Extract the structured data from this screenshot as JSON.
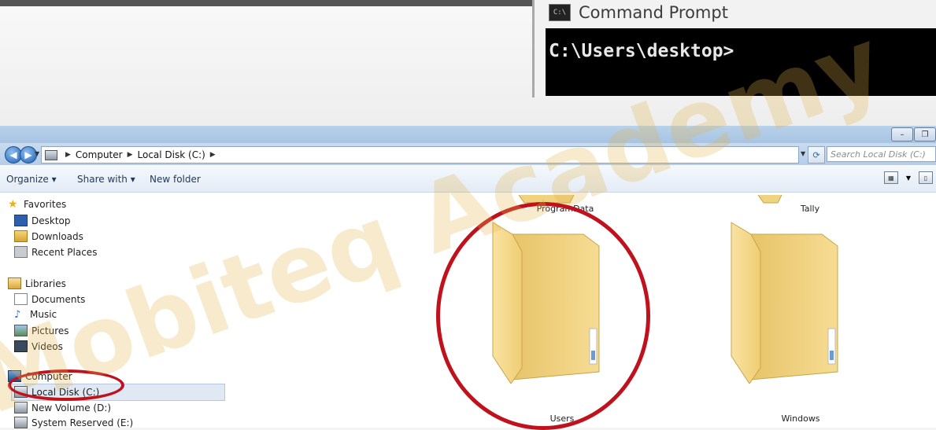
{
  "command_prompt": {
    "title": "Command Prompt",
    "icon_text": "C:\\",
    "prompt_line": "C:\\Users\\desktop>"
  },
  "explorer": {
    "breadcrumb": [
      "Computer",
      "Local Disk (C:)"
    ],
    "search_placeholder": "Search Local Disk (C:)",
    "toolbar": {
      "organize": "Organize ▾",
      "share_with": "Share with ▾",
      "new_folder": "New folder"
    },
    "nav": {
      "favorites": {
        "label": "Favorites",
        "items": [
          "Desktop",
          "Downloads",
          "Recent Places"
        ]
      },
      "libraries": {
        "label": "Libraries",
        "items": [
          "Documents",
          "Music",
          "Pictures",
          "Videos"
        ]
      },
      "computer": {
        "label": "Computer",
        "items": [
          "Local Disk (C:)",
          "New Volume (D:)",
          "System Reserved (E:)"
        ]
      }
    },
    "folders_top": [
      "ProgramData",
      "Tally"
    ],
    "folders": [
      "Users",
      "Windows"
    ]
  },
  "watermark": "Mobiteq Academy",
  "colors": {
    "highlight_ring": "#c0121c",
    "watermark": "#e3b24a"
  }
}
